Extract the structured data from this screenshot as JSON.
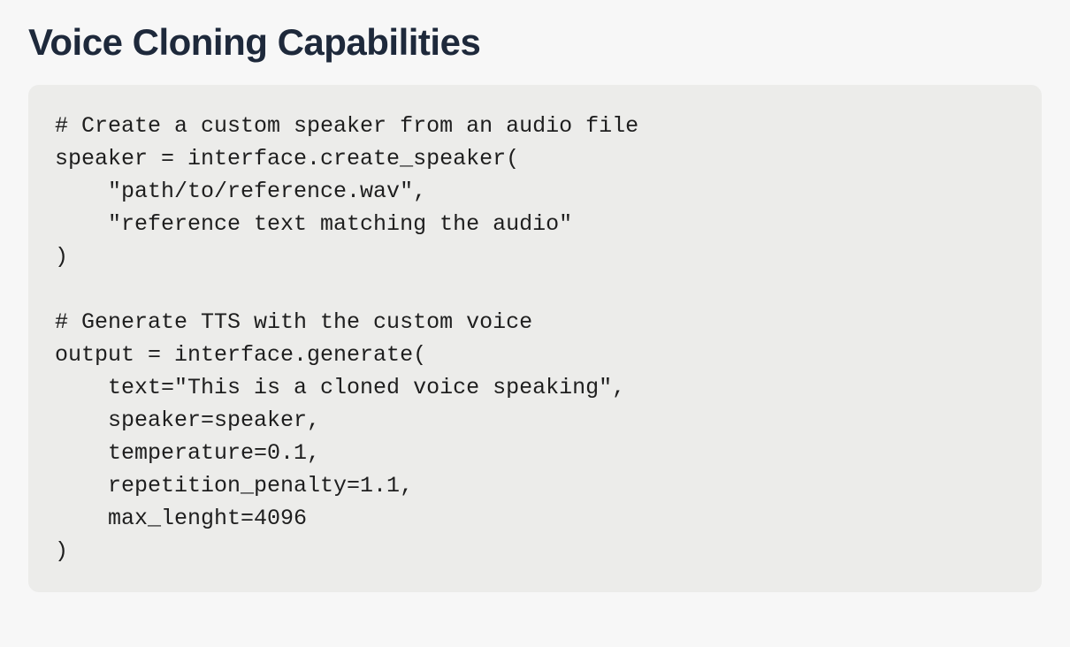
{
  "heading": "Voice Cloning Capabilities",
  "code": "# Create a custom speaker from an audio file\nspeaker = interface.create_speaker(\n    \"path/to/reference.wav\",\n    \"reference text matching the audio\"\n)\n\n# Generate TTS with the custom voice\noutput = interface.generate(\n    text=\"This is a cloned voice speaking\",\n    speaker=speaker,\n    temperature=0.1,\n    repetition_penalty=1.1,\n    max_lenght=4096\n)"
}
